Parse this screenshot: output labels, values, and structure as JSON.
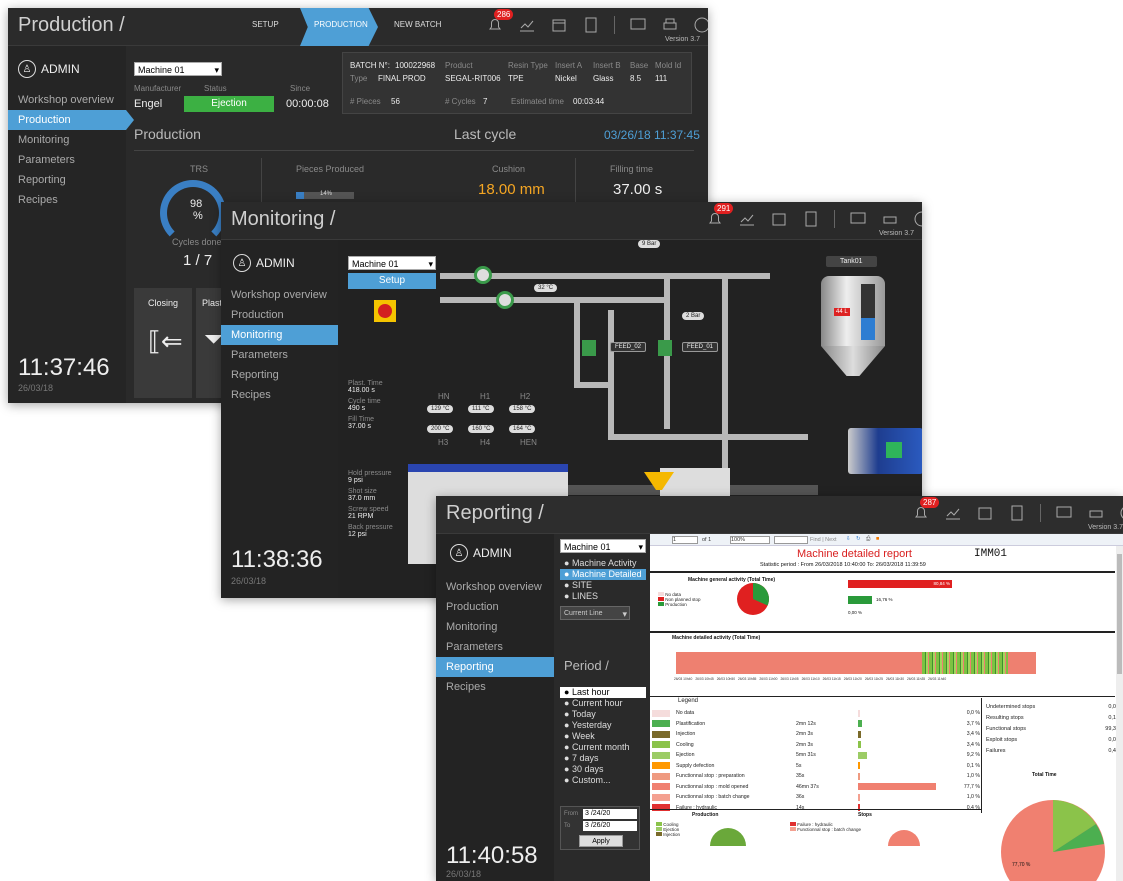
{
  "production": {
    "title": "Production /",
    "tabs": [
      "SETUP",
      "PRODUCTION",
      "NEW BATCH"
    ],
    "badge": "286",
    "version": "Version 3.7",
    "admin": "ADMIN",
    "nav": [
      "Workshop overview",
      "Production",
      "Monitoring",
      "Parameters",
      "Reporting",
      "Recipes"
    ],
    "clock": "11:37:46",
    "date": "26/03/18",
    "machine": "Machine 01",
    "manufacturer_label": "Manufacturer",
    "manufacturer": "Engel",
    "status_label": "Status",
    "status": "Ejection",
    "since_label": "Since",
    "since": "00:00:08",
    "batch": {
      "batch_label": "BATCH N°:",
      "batch_no": "100022968",
      "product_label": "Product",
      "resin_label": "Resin Type",
      "inserta_label": "Insert A",
      "insertb_label": "Insert B",
      "base_label": "Base",
      "mold_label": "Mold Id",
      "type_label": "Type",
      "type": "FINAL PROD",
      "product": "SEGAL-RIT006",
      "resin": "TPE",
      "inserta": "Nickel",
      "insertb": "Glass",
      "base": "8.5",
      "mold": "111",
      "pieces_label": "# Pieces",
      "pieces": "56",
      "cycles_label": "# Cycles",
      "cycles": "7",
      "est_label": "Estimated time",
      "est": "00:03:44"
    },
    "section_production": "Production",
    "section_lastcycle": "Last cycle",
    "lastcycle_time": "03/26/18 11:37:45",
    "trs_label": "TRS",
    "trs_value": "98",
    "trs_unit": "%",
    "pieces_produced_label": "Pieces Produced",
    "pieces_progress": "14%",
    "cushion_label": "Cushion",
    "cushion": "18.00 mm",
    "filling_label": "Filling time",
    "filling": "37.00 s",
    "cycles_done_label": "Cycles done",
    "cycles_done": "1 / 7",
    "closing": "Closing",
    "plasti": "Plasti"
  },
  "monitoring": {
    "title": "Monitoring /",
    "badge": "291",
    "version": "Version 3.7",
    "admin": "ADMIN",
    "nav": [
      "Workshop overview",
      "Production",
      "Monitoring",
      "Parameters",
      "Reporting",
      "Recipes"
    ],
    "clock": "11:38:36",
    "date": "26/03/18",
    "machine": "Machine 01",
    "setup": "Setup",
    "params": [
      [
        "Plast. Time",
        "418.00 s"
      ],
      [
        "Cycle time",
        "490 s"
      ],
      [
        "Fill Time",
        "37.00 s"
      ]
    ],
    "params2": [
      [
        "Hold pressure",
        "9 psi"
      ],
      [
        "Shot size",
        "37.0 mm"
      ],
      [
        "Screw speed",
        "21 RPM"
      ],
      [
        "Back pressure",
        "12 psi"
      ]
    ],
    "heaters_top": [
      "HN",
      "H1",
      "H2"
    ],
    "heaters_top_vals": [
      "129 °C",
      "111 °C",
      "158 °C"
    ],
    "heaters_bot_vals": [
      "200 °C",
      "160 °C",
      "164 °C"
    ],
    "heaters_bot": [
      "H3",
      "H4",
      "HEN"
    ],
    "tank": "Tank01",
    "tank_level": "44 L",
    "p9": "9 Bar",
    "t32": "32 °C",
    "p2": "2 Bar",
    "feed2": "FEED_02",
    "feed1": "FEED_01"
  },
  "reporting": {
    "title": "Reporting /",
    "badge": "287",
    "version": "Version 3.7",
    "admin": "ADMIN",
    "nav": [
      "Workshop overview",
      "Production",
      "Monitoring",
      "Parameters",
      "Reporting",
      "Recipes"
    ],
    "clock": "11:40:58",
    "date": "26/03/18",
    "machine": "Machine 01",
    "reports": [
      "Machine Activity",
      "Machine Detailed",
      "SITE",
      "LINES"
    ],
    "scope": "Current Line",
    "period_title": "Period /",
    "periods": [
      "Last hour",
      "Current hour",
      "Today",
      "Yesterday",
      "Week",
      "Current month",
      "7 days",
      "30 days",
      "Custom..."
    ],
    "from_label": "From",
    "from": "3 /24/20",
    "to_label": "To",
    "to": "3 /26/20",
    "apply": "Apply",
    "toolbar": {
      "page": "1",
      "of": "of 1",
      "zoom": "100%",
      "find": "Find | Next"
    },
    "report_title": "Machine detailed report",
    "report_machine": "IMM01",
    "period_text": "Statistic period : From   26/03/2018 10:40:00       To:  26/03/2018 11:39:59",
    "general_title": "Machine general activity (Total Time)",
    "gen_legend": [
      "No data",
      "Non planned stop",
      "Production"
    ],
    "gen_bar1": "80,84 %",
    "gen_bar2": "16,76 %",
    "gen_bar3": "0,00 %",
    "detailed_title": "Machine detailed activity (Total Time)",
    "timeline": [
      "26/03 10h40",
      "26/03 10h45",
      "26/03 10h50",
      "26/03 10h55",
      "26/03 11h00",
      "26/03 11h05",
      "26/03 11h10",
      "26/03 11h15",
      "26/03 11h20",
      "26/03 11h25",
      "26/03 11h30",
      "26/03 11h35",
      "26/03 11h40"
    ],
    "legend_header": "Legend",
    "legend_rows": [
      {
        "name": "No data",
        "time": "",
        "pct": "0,0 %",
        "color": "#f5dcdc",
        "bar": 0
      },
      {
        "name": "Plastification",
        "time": "2mn 12s",
        "pct": "3,7 %",
        "color": "#4caf50",
        "bar": 3.7
      },
      {
        "name": "Injection",
        "time": "2mn 3s",
        "pct": "3,4 %",
        "color": "#7a6a2a",
        "bar": 3.4
      },
      {
        "name": "Cooling",
        "time": "2mn 3s",
        "pct": "3,4 %",
        "color": "#8bc34a",
        "bar": 3.4
      },
      {
        "name": "Ejection",
        "time": "5mn 31s",
        "pct": "9,2 %",
        "color": "#9ccc65",
        "bar": 9.2
      },
      {
        "name": "Supply defection",
        "time": "5s",
        "pct": "0,1 %",
        "color": "#ff9800",
        "bar": 0.1
      },
      {
        "name": "Functionnal stop : preparation",
        "time": "35s",
        "pct": "1,0 %",
        "color": "#ef9a80",
        "bar": 1
      },
      {
        "name": "Functionnal stop : mold opened",
        "time": "46mn 37s",
        "pct": "77,7 %",
        "color": "#f08070",
        "bar": 77.7
      },
      {
        "name": "Functionnal stop : batch change",
        "time": "36s",
        "pct": "1,0 %",
        "color": "#f4a090",
        "bar": 1
      },
      {
        "name": "Failure : hydraulic",
        "time": "14s",
        "pct": "0,4 %",
        "color": "#e03030",
        "bar": 0.4
      }
    ],
    "stops": [
      [
        "Undetermined stops",
        "0,0"
      ],
      [
        "Resulting stops",
        "0,1"
      ],
      [
        "Functional stops",
        "99,3"
      ],
      [
        "Exploit stops",
        "0,0"
      ],
      [
        "Failures",
        "0,4"
      ]
    ],
    "total_time": "Total Time",
    "pie_label": "77,70 %",
    "bottom_production": "Production",
    "bottom_stops": "Stops",
    "bottom_prod_legend": [
      "Cooling",
      "Ejection",
      "Injection"
    ],
    "bottom_stop_legend": [
      "Failure : hydraulic",
      "Functionnal stop : batch change"
    ]
  }
}
